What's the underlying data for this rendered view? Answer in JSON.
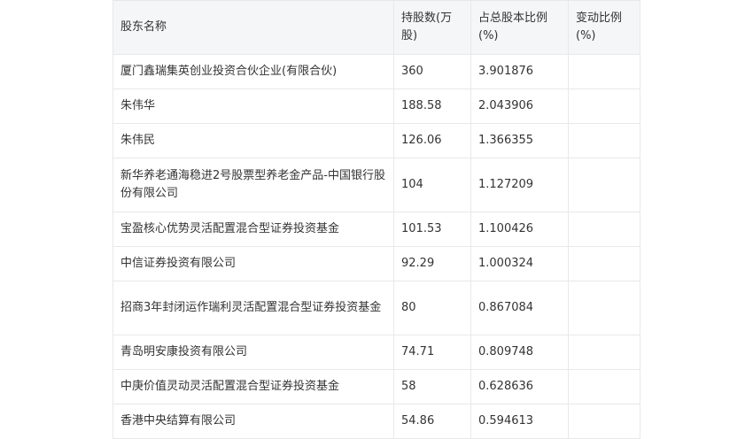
{
  "table": {
    "headers": {
      "name": "股东名称",
      "shares": "持股数(万股)",
      "ratio": "占总股本比例(%)",
      "change": "变动比例(%)"
    },
    "rows": [
      {
        "name": "厦门鑫瑞集英创业投资合伙企业(有限合伙)",
        "shares": "360",
        "ratio": "3.901876",
        "change": ""
      },
      {
        "name": "朱伟华",
        "shares": "188.58",
        "ratio": "2.043906",
        "change": ""
      },
      {
        "name": "朱伟民",
        "shares": "126.06",
        "ratio": "1.366355",
        "change": ""
      },
      {
        "name": "新华养老通海稳进2号股票型养老金产品-中国银行股份有限公司",
        "shares": "104",
        "ratio": "1.127209",
        "change": ""
      },
      {
        "name": "宝盈核心优势灵活配置混合型证券投资基金",
        "shares": "101.53",
        "ratio": "1.100426",
        "change": ""
      },
      {
        "name": "中信证券投资有限公司",
        "shares": "92.29",
        "ratio": "1.000324",
        "change": ""
      },
      {
        "name": "招商3年封闭运作瑞利灵活配置混合型证券投资基金",
        "shares": "80",
        "ratio": "0.867084",
        "change": ""
      },
      {
        "name": "青岛明安康投资有限公司",
        "shares": "74.71",
        "ratio": "0.809748",
        "change": ""
      },
      {
        "name": "中庚价值灵动灵活配置混合型证券投资基金",
        "shares": "58",
        "ratio": "0.628636",
        "change": ""
      },
      {
        "name": "香港中央结算有限公司",
        "shares": "54.86",
        "ratio": "0.594613",
        "change": ""
      }
    ]
  }
}
